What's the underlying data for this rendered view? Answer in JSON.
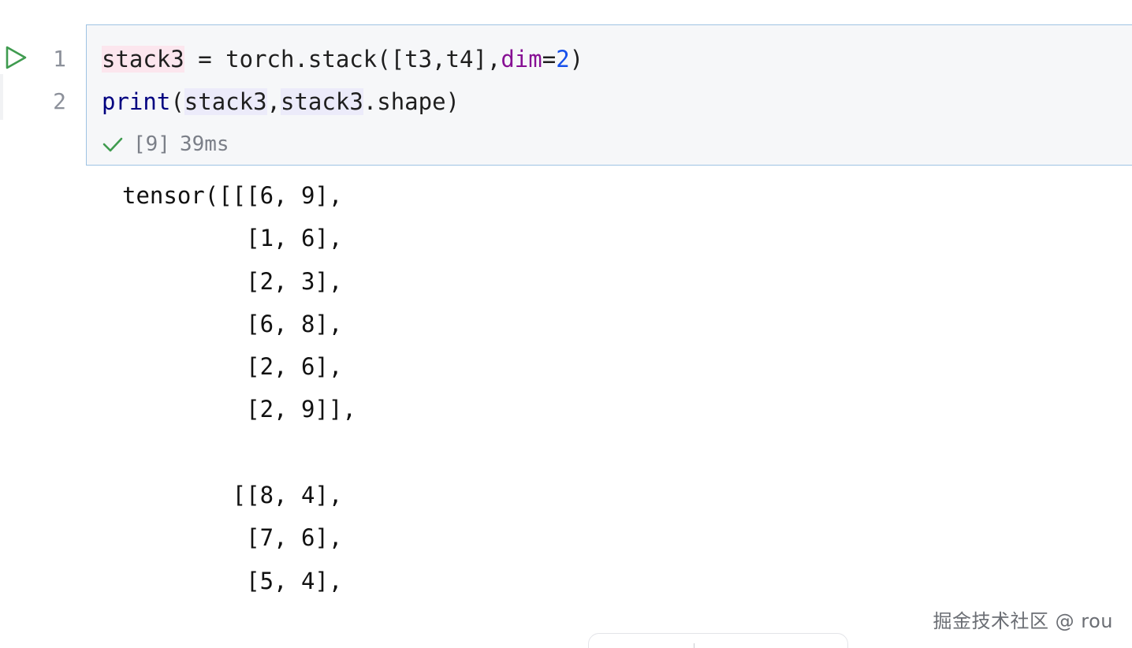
{
  "cell": {
    "line_numbers": [
      "1",
      "2"
    ],
    "line1": {
      "var": "stack3",
      "assign": " = torch.stack([t3,t4],",
      "param": "dim",
      "eq": "=",
      "value": "2",
      "close": ")"
    },
    "line2": {
      "func": "print",
      "open": "(",
      "arg1": "stack3",
      "comma": ",",
      "arg2": "stack3",
      "rest": ".shape)"
    },
    "execution": {
      "count": "[9]",
      "duration": "39ms"
    }
  },
  "output": {
    "text": "tensor([[[6, 9],\n         [1, 6],\n         [2, 3],\n         [6, 8],\n         [2, 6],\n         [2, 9]],\n\n        [[8, 4],\n         [7, 6],\n         [5, 4],"
  },
  "watermark": {
    "text": "掘金技术社区 @ rou"
  },
  "colors": {
    "run_icon": "#3f9b4f",
    "check_icon": "#3f9b4f",
    "cell_border": "#9fc3e3",
    "cell_background": "#f6f7f9",
    "number_literal": "#1750eb",
    "keyword_param": "#871094"
  },
  "icons": {
    "run": "play-triangle-outline",
    "status": "checkmark"
  }
}
